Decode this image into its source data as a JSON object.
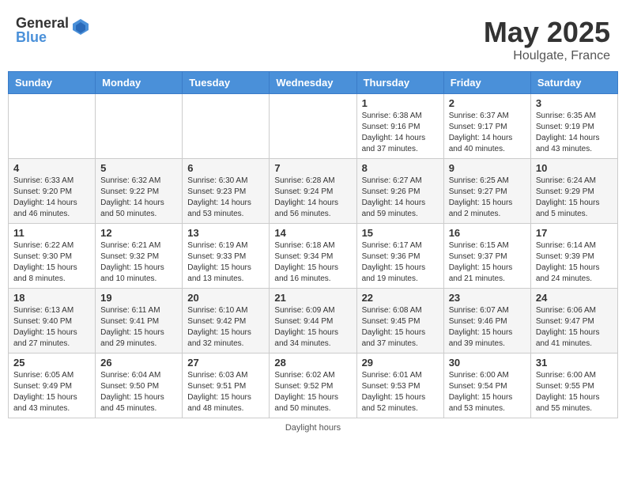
{
  "logo": {
    "general": "General",
    "blue": "Blue"
  },
  "title": {
    "month": "May 2025",
    "location": "Houlgate, France"
  },
  "weekdays": [
    "Sunday",
    "Monday",
    "Tuesday",
    "Wednesday",
    "Thursday",
    "Friday",
    "Saturday"
  ],
  "weeks": [
    [
      {
        "day": "",
        "info": ""
      },
      {
        "day": "",
        "info": ""
      },
      {
        "day": "",
        "info": ""
      },
      {
        "day": "",
        "info": ""
      },
      {
        "day": "1",
        "info": "Sunrise: 6:38 AM\nSunset: 9:16 PM\nDaylight: 14 hours\nand 37 minutes."
      },
      {
        "day": "2",
        "info": "Sunrise: 6:37 AM\nSunset: 9:17 PM\nDaylight: 14 hours\nand 40 minutes."
      },
      {
        "day": "3",
        "info": "Sunrise: 6:35 AM\nSunset: 9:19 PM\nDaylight: 14 hours\nand 43 minutes."
      }
    ],
    [
      {
        "day": "4",
        "info": "Sunrise: 6:33 AM\nSunset: 9:20 PM\nDaylight: 14 hours\nand 46 minutes."
      },
      {
        "day": "5",
        "info": "Sunrise: 6:32 AM\nSunset: 9:22 PM\nDaylight: 14 hours\nand 50 minutes."
      },
      {
        "day": "6",
        "info": "Sunrise: 6:30 AM\nSunset: 9:23 PM\nDaylight: 14 hours\nand 53 minutes."
      },
      {
        "day": "7",
        "info": "Sunrise: 6:28 AM\nSunset: 9:24 PM\nDaylight: 14 hours\nand 56 minutes."
      },
      {
        "day": "8",
        "info": "Sunrise: 6:27 AM\nSunset: 9:26 PM\nDaylight: 14 hours\nand 59 minutes."
      },
      {
        "day": "9",
        "info": "Sunrise: 6:25 AM\nSunset: 9:27 PM\nDaylight: 15 hours\nand 2 minutes."
      },
      {
        "day": "10",
        "info": "Sunrise: 6:24 AM\nSunset: 9:29 PM\nDaylight: 15 hours\nand 5 minutes."
      }
    ],
    [
      {
        "day": "11",
        "info": "Sunrise: 6:22 AM\nSunset: 9:30 PM\nDaylight: 15 hours\nand 8 minutes."
      },
      {
        "day": "12",
        "info": "Sunrise: 6:21 AM\nSunset: 9:32 PM\nDaylight: 15 hours\nand 10 minutes."
      },
      {
        "day": "13",
        "info": "Sunrise: 6:19 AM\nSunset: 9:33 PM\nDaylight: 15 hours\nand 13 minutes."
      },
      {
        "day": "14",
        "info": "Sunrise: 6:18 AM\nSunset: 9:34 PM\nDaylight: 15 hours\nand 16 minutes."
      },
      {
        "day": "15",
        "info": "Sunrise: 6:17 AM\nSunset: 9:36 PM\nDaylight: 15 hours\nand 19 minutes."
      },
      {
        "day": "16",
        "info": "Sunrise: 6:15 AM\nSunset: 9:37 PM\nDaylight: 15 hours\nand 21 minutes."
      },
      {
        "day": "17",
        "info": "Sunrise: 6:14 AM\nSunset: 9:39 PM\nDaylight: 15 hours\nand 24 minutes."
      }
    ],
    [
      {
        "day": "18",
        "info": "Sunrise: 6:13 AM\nSunset: 9:40 PM\nDaylight: 15 hours\nand 27 minutes."
      },
      {
        "day": "19",
        "info": "Sunrise: 6:11 AM\nSunset: 9:41 PM\nDaylight: 15 hours\nand 29 minutes."
      },
      {
        "day": "20",
        "info": "Sunrise: 6:10 AM\nSunset: 9:42 PM\nDaylight: 15 hours\nand 32 minutes."
      },
      {
        "day": "21",
        "info": "Sunrise: 6:09 AM\nSunset: 9:44 PM\nDaylight: 15 hours\nand 34 minutes."
      },
      {
        "day": "22",
        "info": "Sunrise: 6:08 AM\nSunset: 9:45 PM\nDaylight: 15 hours\nand 37 minutes."
      },
      {
        "day": "23",
        "info": "Sunrise: 6:07 AM\nSunset: 9:46 PM\nDaylight: 15 hours\nand 39 minutes."
      },
      {
        "day": "24",
        "info": "Sunrise: 6:06 AM\nSunset: 9:47 PM\nDaylight: 15 hours\nand 41 minutes."
      }
    ],
    [
      {
        "day": "25",
        "info": "Sunrise: 6:05 AM\nSunset: 9:49 PM\nDaylight: 15 hours\nand 43 minutes."
      },
      {
        "day": "26",
        "info": "Sunrise: 6:04 AM\nSunset: 9:50 PM\nDaylight: 15 hours\nand 45 minutes."
      },
      {
        "day": "27",
        "info": "Sunrise: 6:03 AM\nSunset: 9:51 PM\nDaylight: 15 hours\nand 48 minutes."
      },
      {
        "day": "28",
        "info": "Sunrise: 6:02 AM\nSunset: 9:52 PM\nDaylight: 15 hours\nand 50 minutes."
      },
      {
        "day": "29",
        "info": "Sunrise: 6:01 AM\nSunset: 9:53 PM\nDaylight: 15 hours\nand 52 minutes."
      },
      {
        "day": "30",
        "info": "Sunrise: 6:00 AM\nSunset: 9:54 PM\nDaylight: 15 hours\nand 53 minutes."
      },
      {
        "day": "31",
        "info": "Sunrise: 6:00 AM\nSunset: 9:55 PM\nDaylight: 15 hours\nand 55 minutes."
      }
    ]
  ],
  "footer": {
    "daylight_label": "Daylight hours"
  },
  "colors": {
    "header_bg": "#4a90d9",
    "accent": "#4a90d9"
  }
}
